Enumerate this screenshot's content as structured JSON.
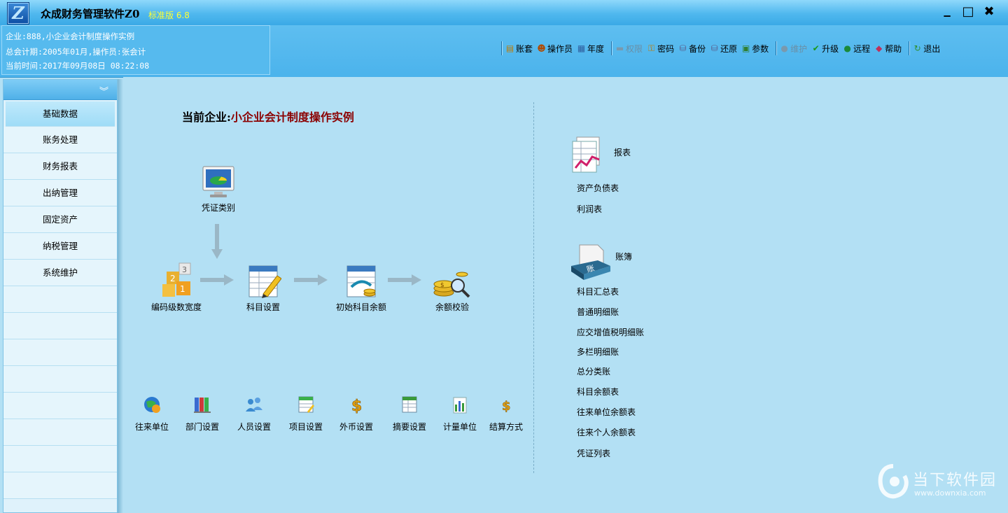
{
  "window": {
    "title": "众成财务管理软件Z0",
    "edition": "标准版 6.8",
    "minimize_label": "▁",
    "restore_label": "□",
    "close_label": "✖"
  },
  "info": {
    "company": "企业:888,小企业会计制度操作实例",
    "period": "总会计期:2005年01月,操作员:张会计",
    "time": "当前时间:2017年09月08日  08:22:08"
  },
  "toolbar": {
    "zhangtao": "账套",
    "operator": "操作员",
    "year": "年度",
    "permission": "权限",
    "password": "密码",
    "backup": "备份",
    "restore": "还原",
    "params": "参数",
    "maintain": "维护",
    "upgrade": "升级",
    "remote": "远程",
    "help": "帮助",
    "exit": "退出"
  },
  "sidebar": {
    "collapse": "︾",
    "items": [
      "基础数据",
      "账务处理",
      "财务报表",
      "出纳管理",
      "固定资产",
      "纳税管理",
      "系统维护"
    ]
  },
  "main": {
    "company_prefix": "当前企业:",
    "company_name": "小企业会计制度操作实例",
    "flow": {
      "voucher_type": "凭证类别",
      "code_level": "编码级数宽度",
      "subject_setup": "科目设置",
      "initial_balance": "初始科目余额",
      "balance_check": "余额校验"
    },
    "basics": [
      "往来单位",
      "部门设置",
      "人员设置",
      "项目设置",
      "外币设置",
      "摘要设置",
      "计量单位",
      "结算方式"
    ],
    "reports_title": "报表",
    "reports": [
      "资产负债表",
      "利润表"
    ],
    "ledger_title": "账簿",
    "ledger_icon_text": "账",
    "ledgers": [
      "科目汇总表",
      "普通明细账",
      "应交增值税明细账",
      "多栏明细账",
      "总分类账",
      "科目余额表",
      "往来单位余额表",
      "往来个人余额表",
      "凭证列表"
    ]
  },
  "watermark": {
    "name": "当下软件园",
    "url": "www.downxia.com"
  },
  "colors": {
    "titlebar": "#4fb8ee",
    "background": "#b3e0f4",
    "company_name": "#8b0000",
    "edition": "#ffff33"
  }
}
